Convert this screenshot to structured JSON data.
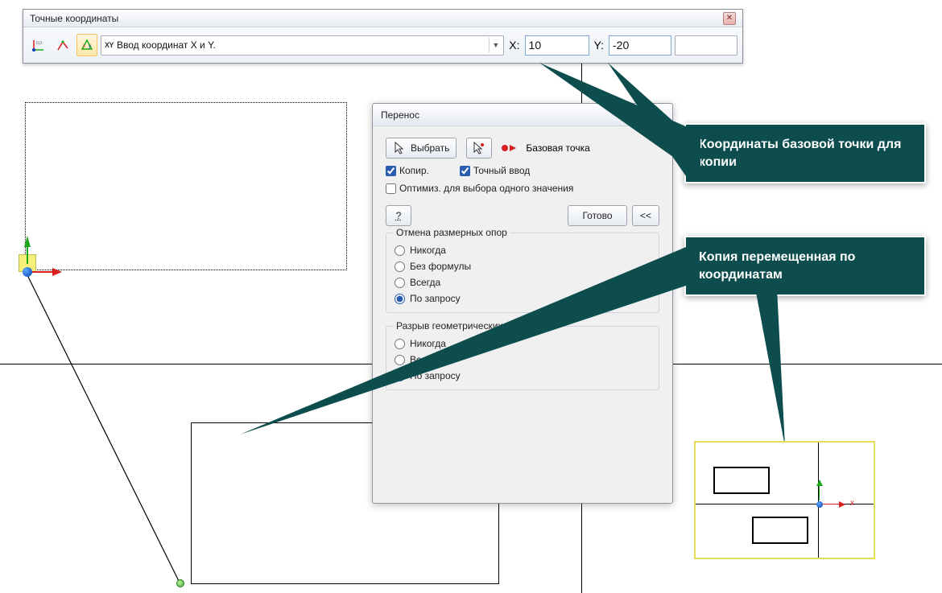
{
  "toolbar": {
    "title": "Точные координаты",
    "combo_prefix": "XY",
    "combo_text": "Ввод координат X и Y.",
    "x_label": "X:",
    "y_label": "Y:",
    "x_value": "10",
    "y_value": "-20"
  },
  "dialog": {
    "title": "Перенос",
    "select_btn": "Выбрать",
    "base_point": "Базовая точка",
    "copy_cb": "Копир.",
    "exact_cb": "Точный ввод",
    "optimize_cb": "Оптимиз. для выбора одного значения",
    "done_btn": "Готово",
    "collapse_btn": "<<",
    "group1": {
      "legend": "Отмена размерных опор",
      "opts": [
        "Никогда",
        "Без формулы",
        "Всегда",
        "По запросу"
      ],
      "selected": 3
    },
    "group2": {
      "legend": "Разрыв геометрических опор",
      "opts": [
        "Никогда",
        "Всегда",
        "По запросу"
      ],
      "selected": 2
    }
  },
  "callouts": {
    "top": "Координаты базовой точки для копии",
    "bottom": "Копия перемещенная по координатам"
  },
  "preview": {
    "x_letter": "x"
  }
}
